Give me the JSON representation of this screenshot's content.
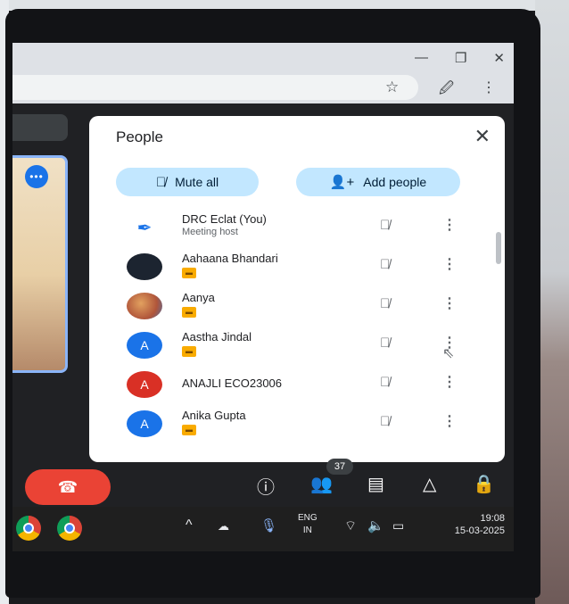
{
  "browser": {
    "minimize_glyph": "—",
    "restore_glyph": "❐",
    "close_glyph": "✕",
    "bookmark_icon": "star-icon",
    "extensions_icon": "extensions-icon",
    "menu_glyph": "⋮"
  },
  "tile": {
    "badge_glyph": "•••"
  },
  "panel": {
    "title": "People",
    "close_glyph": "✕",
    "mute_all_label": "Mute all",
    "add_people_label": "Add people",
    "participants": [
      {
        "name": "DRC Eclat (You)",
        "subtitle": "Meeting host",
        "avatar": "",
        "avatar_color": "#ffffff"
      },
      {
        "name": "Aahaana Bhandari",
        "subtitle": "",
        "avatar": "",
        "avatar_color": "#1c2430"
      },
      {
        "name": "Aanya",
        "subtitle": "",
        "avatar": "",
        "avatar_color": "#b0553a"
      },
      {
        "name": "Aastha Jindal",
        "subtitle": "",
        "avatar": "A",
        "avatar_color": "#1a73e8"
      },
      {
        "name": "ANAJLI ECO23006",
        "subtitle": "",
        "avatar": "A",
        "avatar_color": "#d93025"
      },
      {
        "name": "Anika Gupta",
        "subtitle": "",
        "avatar": "A",
        "avatar_color": "#1a73e8"
      }
    ]
  },
  "controls": {
    "end_call_glyph": "☎",
    "info_glyph": "ⓘ",
    "people_glyph": "👥",
    "people_count": "37",
    "chat_glyph": "▤",
    "activities_glyph": "△",
    "host_controls_glyph": "🔒"
  },
  "taskbar": {
    "chevron_glyph": "^",
    "lang_line1": "ENG",
    "lang_line2": "IN",
    "time": "19:08",
    "date": "15-03-2025"
  },
  "colors": {
    "accent": "#c2e7ff",
    "end_call": "#ea4335",
    "taskbar": "#1f1f1f"
  }
}
